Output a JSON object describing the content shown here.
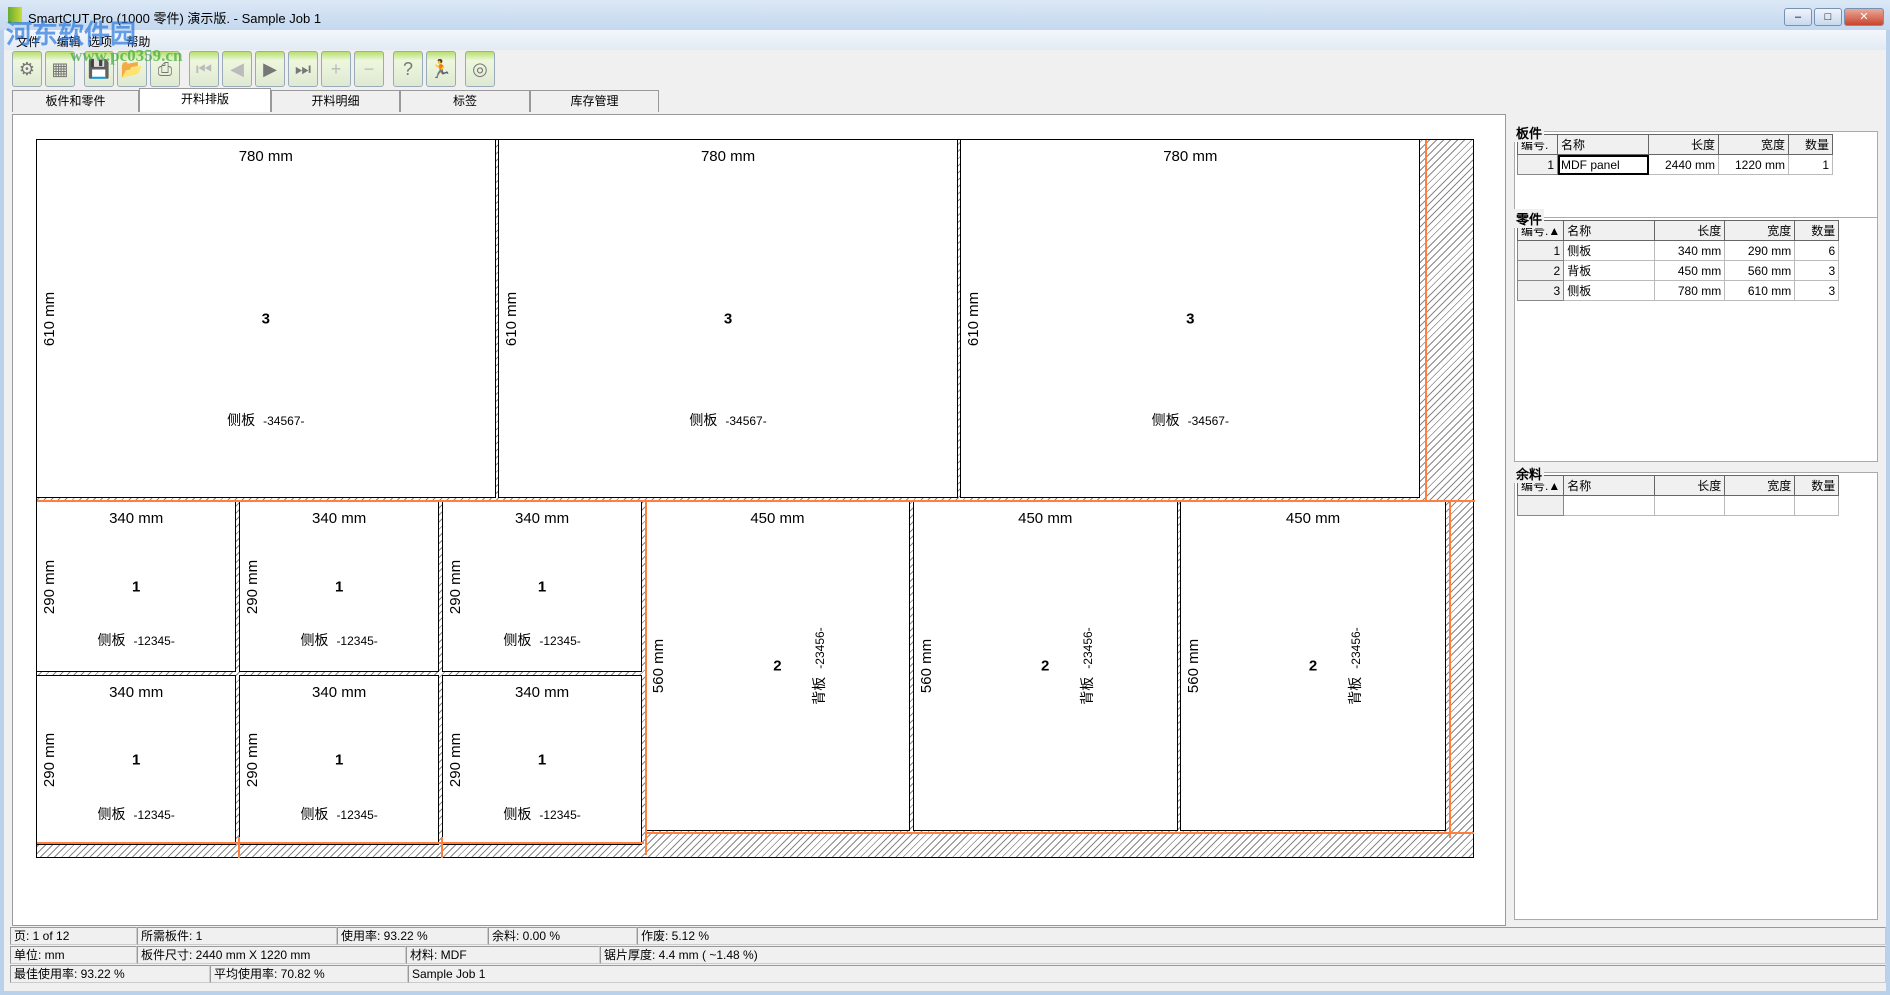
{
  "window": {
    "title": "SmartCUT Pro (1000 零件) 演示版. - Sample Job 1",
    "min": "–",
    "max": "□",
    "close": "✕"
  },
  "watermark": {
    "text": "河东软件园",
    "url": "www.pc0359.cn"
  },
  "menu": [
    "文件",
    "编辑",
    "选项",
    "帮助"
  ],
  "toolbar": [
    {
      "icon": "gear-icon",
      "glyph": "⚙",
      "enabled": true
    },
    {
      "icon": "waveform-icon",
      "glyph": "▦",
      "enabled": true
    },
    {
      "icon": "save-icon",
      "glyph": "💾",
      "enabled": true
    },
    {
      "icon": "open-folder-icon",
      "glyph": "📂",
      "enabled": true
    },
    {
      "icon": "print-icon",
      "glyph": "⎙",
      "enabled": true
    },
    {
      "icon": "first-page-icon",
      "glyph": "⏮",
      "enabled": false
    },
    {
      "icon": "prev-page-icon",
      "glyph": "◀",
      "enabled": false
    },
    {
      "icon": "next-page-icon",
      "glyph": "▶",
      "enabled": true
    },
    {
      "icon": "last-page-icon",
      "glyph": "⏭",
      "enabled": true
    },
    {
      "icon": "plus-icon",
      "glyph": "+",
      "enabled": false
    },
    {
      "icon": "minus-icon",
      "glyph": "−",
      "enabled": false
    },
    {
      "icon": "help-icon",
      "glyph": "?",
      "enabled": true
    },
    {
      "icon": "exit-icon",
      "glyph": "🏃",
      "enabled": true
    },
    {
      "icon": "disc-icon",
      "glyph": "◎",
      "enabled": true
    }
  ],
  "tabs": [
    {
      "label": "板件和零件"
    },
    {
      "label": "开料排版",
      "active": true
    },
    {
      "label": "开料明细"
    },
    {
      "label": "标签"
    },
    {
      "label": "库存管理"
    }
  ],
  "layout": {
    "top_row": [
      {
        "length": "780 mm",
        "width": "610 mm",
        "id": "3",
        "name": "侧板",
        "code": "-34567-"
      },
      {
        "length": "780 mm",
        "width": "610 mm",
        "id": "3",
        "name": "侧板",
        "code": "-34567-"
      },
      {
        "length": "780 mm",
        "width": "610 mm",
        "id": "3",
        "name": "侧板",
        "code": "-34567-"
      }
    ],
    "small": [
      {
        "length": "340 mm",
        "width": "290 mm",
        "id": "1",
        "name": "侧板",
        "code": "-12345-"
      },
      {
        "length": "340 mm",
        "width": "290 mm",
        "id": "1",
        "name": "侧板",
        "code": "-12345-"
      },
      {
        "length": "340 mm",
        "width": "290 mm",
        "id": "1",
        "name": "侧板",
        "code": "-12345-"
      },
      {
        "length": "340 mm",
        "width": "290 mm",
        "id": "1",
        "name": "侧板",
        "code": "-12345-"
      },
      {
        "length": "340 mm",
        "width": "290 mm",
        "id": "1",
        "name": "侧板",
        "code": "-12345-"
      },
      {
        "length": "340 mm",
        "width": "290 mm",
        "id": "1",
        "name": "侧板",
        "code": "-12345-"
      }
    ],
    "large": [
      {
        "length": "450 mm",
        "width": "560 mm",
        "id": "2",
        "name": "背板",
        "code": "-23456-"
      },
      {
        "length": "450 mm",
        "width": "560 mm",
        "id": "2",
        "name": "背板",
        "code": "-23456-"
      },
      {
        "length": "450 mm",
        "width": "560 mm",
        "id": "2",
        "name": "背板",
        "code": "-23456-"
      }
    ],
    "cut_color": "#ff7f3f"
  },
  "panels": {
    "sheets": {
      "title": "板件",
      "headers": [
        "编号.",
        "名称",
        "长度",
        "宽度",
        "数量"
      ],
      "rows": [
        [
          "1",
          "MDF panel",
          "2440 mm",
          "1220 mm",
          "1"
        ]
      ]
    },
    "parts": {
      "title": "零件",
      "headers": [
        "编号.▲",
        "名称",
        "长度",
        "宽度",
        "数量"
      ],
      "rows": [
        [
          "1",
          "侧板",
          "340 mm",
          "290 mm",
          "6"
        ],
        [
          "2",
          "背板",
          "450 mm",
          "560 mm",
          "3"
        ],
        [
          "3",
          "侧板",
          "780 mm",
          "610 mm",
          "3"
        ]
      ]
    },
    "offcuts": {
      "title": "余料",
      "headers": [
        "编号.▲",
        "名称",
        "长度",
        "宽度",
        "数量"
      ],
      "rows": [
        [
          "",
          "",
          "",
          "",
          ""
        ]
      ]
    }
  },
  "status": [
    [
      "页: 1 of 12",
      "所需板件: 1",
      "使用率: 93.22 %",
      "余料: 0.00 %",
      "作废: 5.12 %"
    ],
    [
      "单位: mm",
      "板件尺寸: 2440 mm X 1220 mm",
      "材料: MDF",
      "锯片厚度: 4.4 mm   ( ~1.48 %)"
    ],
    [
      "最佳使用率: 93.22 %",
      "平均使用率: 70.82 %",
      "Sample Job 1"
    ]
  ]
}
